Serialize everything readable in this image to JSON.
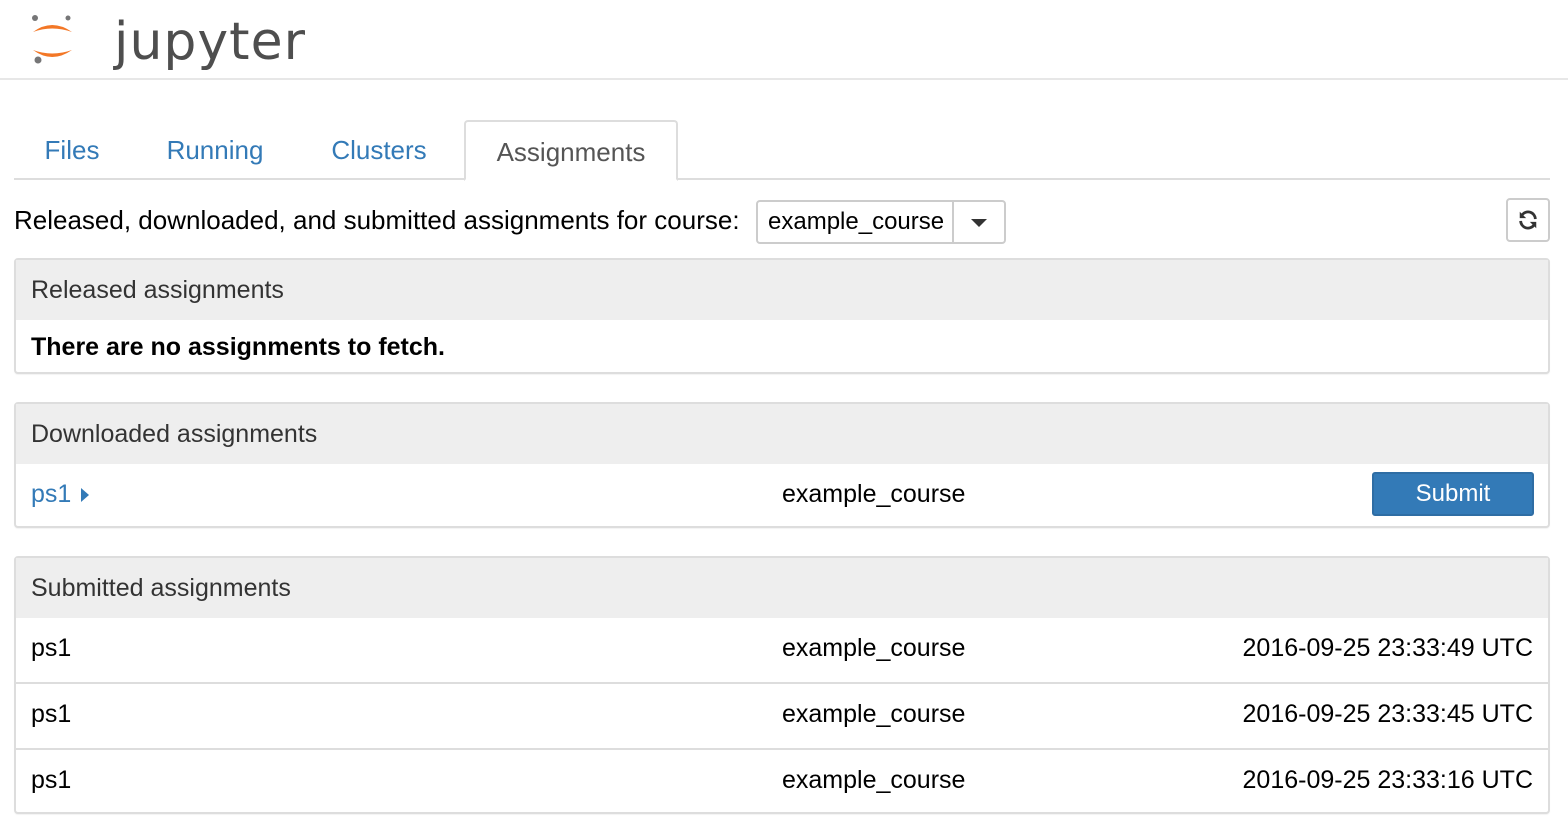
{
  "app": {
    "logo_text": "jupyter",
    "logo_orange": "#f37726",
    "logo_gray": "#767677"
  },
  "tabs": [
    {
      "label": "Files",
      "active": false
    },
    {
      "label": "Running",
      "active": false
    },
    {
      "label": "Clusters",
      "active": false
    },
    {
      "label": "Assignments",
      "active": true
    }
  ],
  "course_filter": {
    "label": "Released, downloaded, and submitted assignments for course:",
    "selected": "example_course",
    "refresh_icon": "refresh-icon"
  },
  "released": {
    "heading": "Released assignments",
    "empty_message": "There are no assignments to fetch."
  },
  "downloaded": {
    "heading": "Downloaded assignments",
    "rows": [
      {
        "name": "ps1",
        "course": "example_course",
        "action": "Submit"
      }
    ]
  },
  "submitted": {
    "heading": "Submitted assignments",
    "rows": [
      {
        "name": "ps1",
        "course": "example_course",
        "timestamp": "2016-09-25 23:33:49 UTC"
      },
      {
        "name": "ps1",
        "course": "example_course",
        "timestamp": "2016-09-25 23:33:45 UTC"
      },
      {
        "name": "ps1",
        "course": "example_course",
        "timestamp": "2016-09-25 23:33:16 UTC"
      }
    ]
  },
  "colors": {
    "link": "#337ab7",
    "primary_button": "#337ab7",
    "panel_heading_bg": "#eeeeee"
  }
}
